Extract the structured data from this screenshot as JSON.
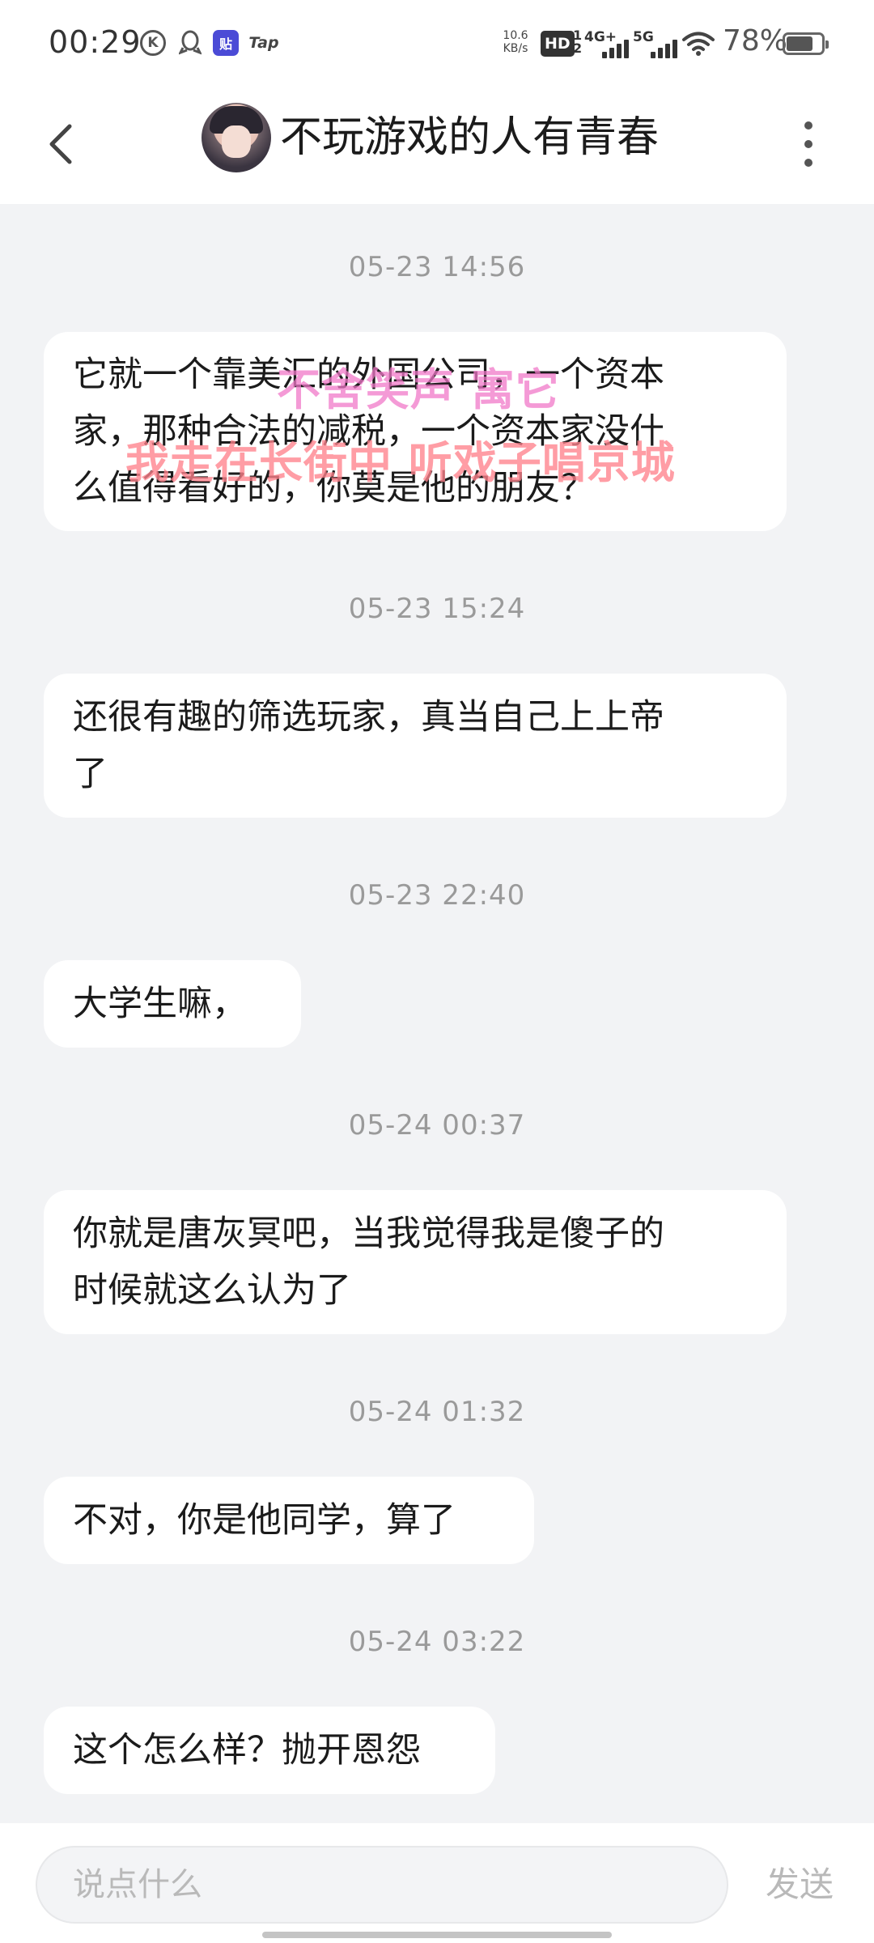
{
  "status_bar": {
    "time": "00:29",
    "app_icons": [
      {
        "name": "k-app-icon",
        "glyph": "K"
      },
      {
        "name": "qq-icon",
        "glyph": ""
      },
      {
        "name": "tieba-icon",
        "glyph": "贴"
      },
      {
        "name": "tap-icon",
        "glyph": "Tap"
      }
    ],
    "net_speed": "10.6",
    "net_speed_unit": "KB/s",
    "hd_label": "HD",
    "hd_sub": "1\n2",
    "signal_4g": "4G+",
    "signal_5g": "5G",
    "battery": "78%"
  },
  "nav": {
    "title": "不玩游戏的人有青春"
  },
  "messages": [
    {
      "time": "05-23 14:56",
      "lines": [
        "它就一个靠美汇的外国公司，一个资本",
        "家，那种合法的减税，一个资本家没什",
        "么值得看好的，你莫是他的朋友？"
      ]
    },
    {
      "time": "05-23 15:24",
      "lines": [
        "还很有趣的筛选玩家，真当自己上上帝",
        "了"
      ]
    },
    {
      "time": "05-23 22:40",
      "lines": [
        "大学生嘛，"
      ]
    },
    {
      "time": "05-24 00:37",
      "lines": [
        "你就是唐灰冥吧，当我觉得我是傻子的",
        "时候就这么认为了"
      ]
    },
    {
      "time": "05-24 01:32",
      "lines": [
        "不对，你是他同学，算了"
      ]
    },
    {
      "time": "05-24 03:22",
      "lines": [
        "这个怎么样？抛开恩怨"
      ]
    }
  ],
  "watermark": {
    "line1": "不舍笑声 寓它",
    "line2": "我走在长街中 听戏子唱京城"
  },
  "input": {
    "placeholder": "说点什么",
    "value": "",
    "send_label": "发送"
  },
  "colors": {
    "background": "#f2f3f5",
    "bubble": "#ffffff",
    "timestamp": "#9a9a9a",
    "watermark": "#ff828c"
  }
}
